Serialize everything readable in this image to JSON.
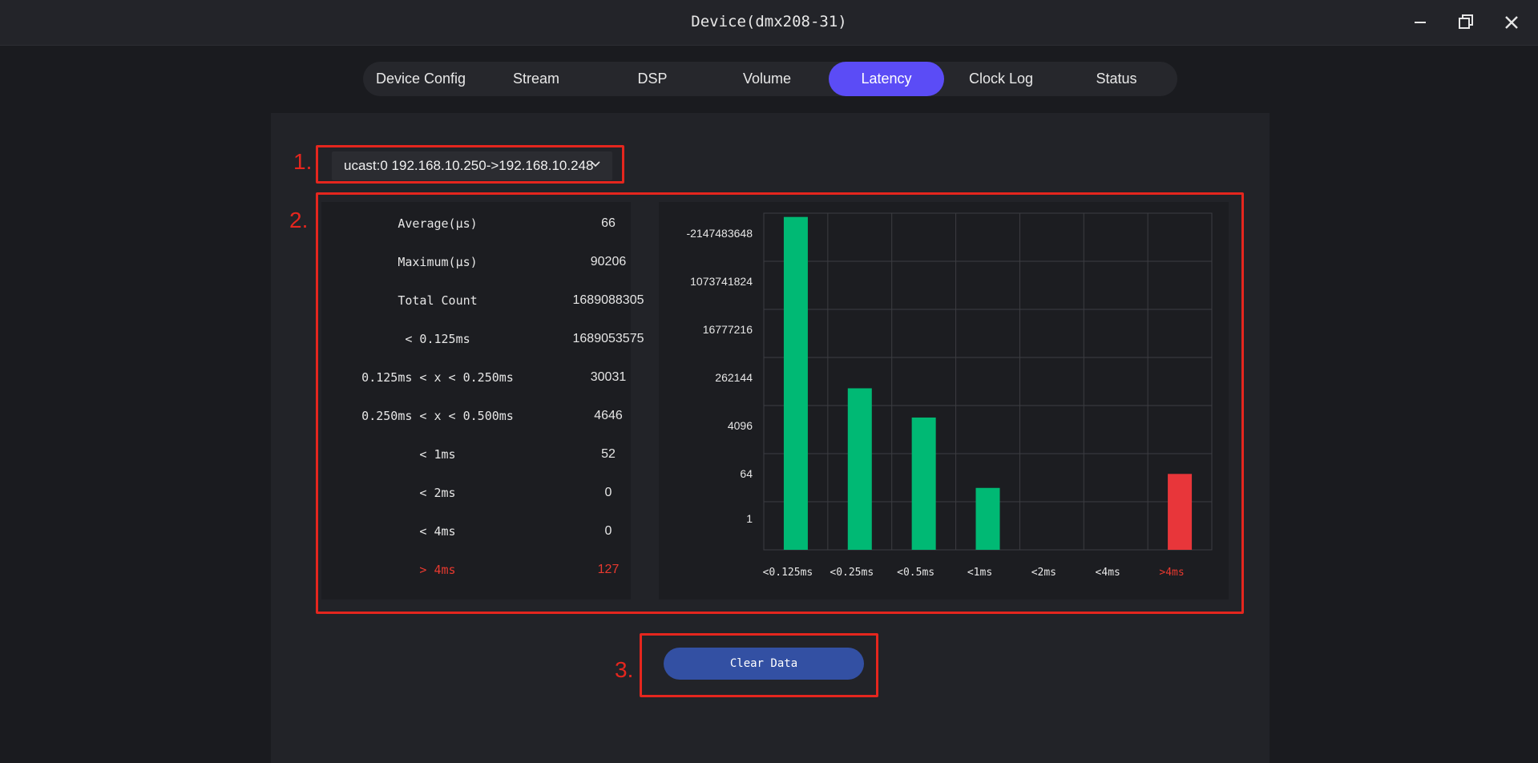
{
  "window": {
    "title": "Device(dmx208-31)"
  },
  "tabs": [
    {
      "label": "Device Config",
      "active": false
    },
    {
      "label": "Stream",
      "active": false
    },
    {
      "label": "DSP",
      "active": false
    },
    {
      "label": "Volume",
      "active": false
    },
    {
      "label": "Latency",
      "active": true
    },
    {
      "label": "Clock Log",
      "active": false
    },
    {
      "label": "Status",
      "active": false
    }
  ],
  "annotations": [
    "1.",
    "2.",
    "3."
  ],
  "stream_select": {
    "value": "ucast:0 192.168.10.250->192.168.10.248"
  },
  "stats": [
    {
      "label": "Average(μs)",
      "value": "66"
    },
    {
      "label": "Maximum(μs)",
      "value": "90206"
    },
    {
      "label": "Total Count",
      "value": "1689088305"
    },
    {
      "label": "< 0.125ms",
      "value": "1689053575"
    },
    {
      "label": "0.125ms < x < 0.250ms",
      "value": "30031"
    },
    {
      "label": "0.250ms < x < 0.500ms",
      "value": "4646"
    },
    {
      "label": "< 1ms",
      "value": "52"
    },
    {
      "label": "< 2ms",
      "value": "0"
    },
    {
      "label": "< 4ms",
      "value": "0"
    },
    {
      "label": "> 4ms",
      "value": "127"
    }
  ],
  "chart_data": {
    "type": "bar",
    "scale": "log",
    "grid": true,
    "categories": [
      "<0.125ms",
      "<0.25ms",
      "<0.5ms",
      "<1ms",
      "<2ms",
      "<4ms",
      ">4ms"
    ],
    "values": [
      1689053575,
      30031,
      4646,
      52,
      0,
      0,
      127
    ],
    "y_tick_labels": [
      "-2147483648",
      "1073741824",
      "16777216",
      "262144",
      "4096",
      "64",
      "1"
    ],
    "colors": {
      "normal": "#00b974",
      "alert": "#e8363a",
      "grid": "#3c3d42",
      "alert_label": "#e8392f"
    }
  },
  "actions": {
    "clear_label": "Clear Data"
  }
}
